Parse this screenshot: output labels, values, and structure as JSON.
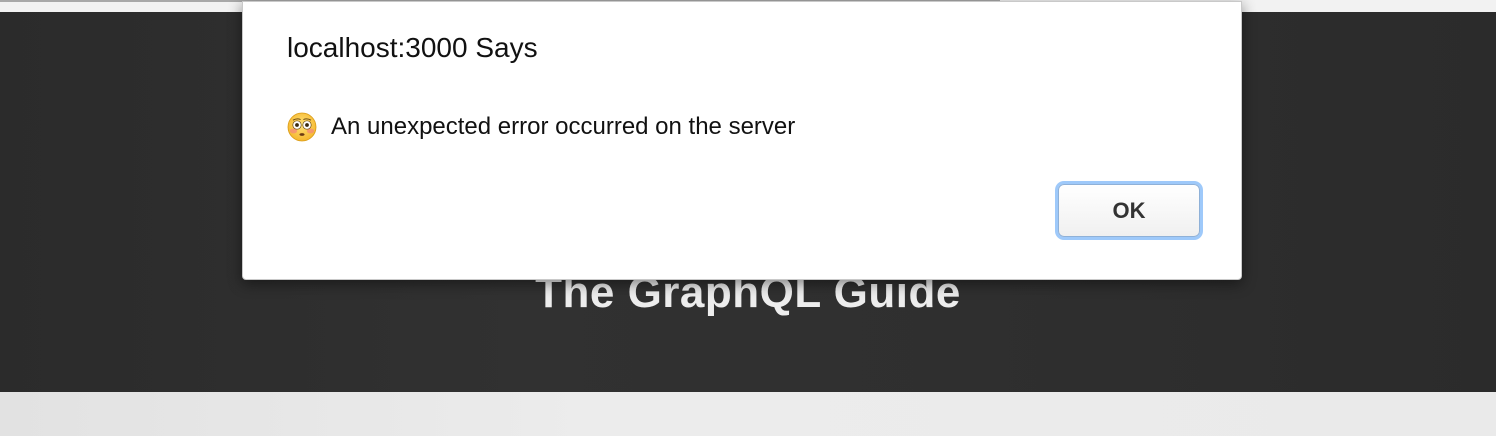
{
  "page": {
    "app_title": "The GraphQL Guide"
  },
  "dialog": {
    "title": "localhost:3000 Says",
    "icon": "flushed-face-emoji",
    "message": "An unexpected error occurred on the server",
    "ok_label": "OK"
  },
  "colors": {
    "header_background": "#2e2e2e",
    "page_background": "#ebebeb",
    "focus_ring": "#9ec9fa"
  }
}
